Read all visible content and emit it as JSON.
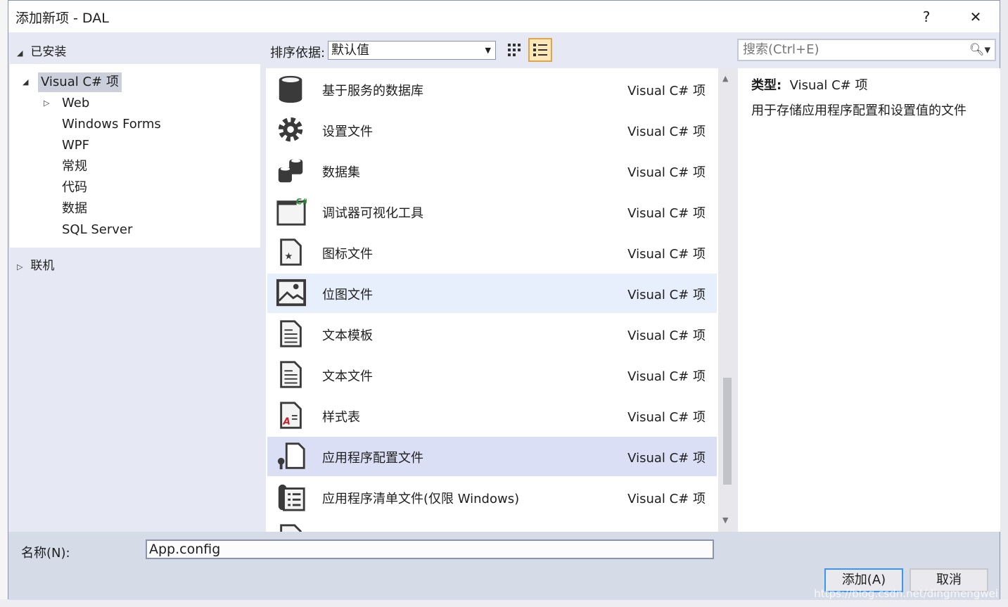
{
  "dialog": {
    "title": "添加新项 - DAL",
    "help": "?",
    "close": "✕"
  },
  "left": {
    "installed": "已安装",
    "tree": [
      {
        "label": "Visual C# 项",
        "expanded": true,
        "selected": true,
        "level": 0
      },
      {
        "label": "Web",
        "expandable": true,
        "level": 1
      },
      {
        "label": "Windows Forms",
        "level": 1
      },
      {
        "label": "WPF",
        "level": 1
      },
      {
        "label": "常规",
        "level": 1
      },
      {
        "label": "代码",
        "level": 1
      },
      {
        "label": "数据",
        "level": 1
      },
      {
        "label": "SQL Server",
        "level": 1
      }
    ],
    "online": "联机"
  },
  "toolbar": {
    "sort_label": "排序依据:",
    "sort_value": "默认值",
    "search_placeholder": "搜索(Ctrl+E)",
    "view_mode": "list"
  },
  "items": [
    {
      "name": "基于服务的数据库",
      "type": "Visual C# 项",
      "icon": "database"
    },
    {
      "name": "设置文件",
      "type": "Visual C# 项",
      "icon": "gear"
    },
    {
      "name": "数据集",
      "type": "Visual C# 项",
      "icon": "dataset"
    },
    {
      "name": "调试器可视化工具",
      "type": "Visual C# 项",
      "icon": "window-csharp"
    },
    {
      "name": "图标文件",
      "type": "Visual C# 项",
      "icon": "icon-file"
    },
    {
      "name": "位图文件",
      "type": "Visual C# 项",
      "icon": "image",
      "state": "hover"
    },
    {
      "name": "文本模板",
      "type": "Visual C# 项",
      "icon": "text-document"
    },
    {
      "name": "文本文件",
      "type": "Visual C# 项",
      "icon": "text-document"
    },
    {
      "name": "样式表",
      "type": "Visual C# 项",
      "icon": "stylesheet"
    },
    {
      "name": "应用程序配置文件",
      "type": "Visual C# 项",
      "icon": "config-file",
      "state": "selected"
    },
    {
      "name": "应用程序清单文件(仅限 Windows)",
      "type": "Visual C# 项",
      "icon": "manifest"
    }
  ],
  "detail": {
    "type_label": "类型:",
    "type_value": "Visual C# 项",
    "description": "用于存储应用程序配置和设置值的文件"
  },
  "bottom": {
    "name_label": "名称(N):",
    "name_value": "App.config",
    "add": "添加(A)",
    "cancel": "取消"
  },
  "watermark": "https://blog.csdn.net/dingmengwei",
  "colors": {
    "selected_row": "#dadff5",
    "hover_row": "#e8effc",
    "primary_border": "#3e95f0"
  }
}
